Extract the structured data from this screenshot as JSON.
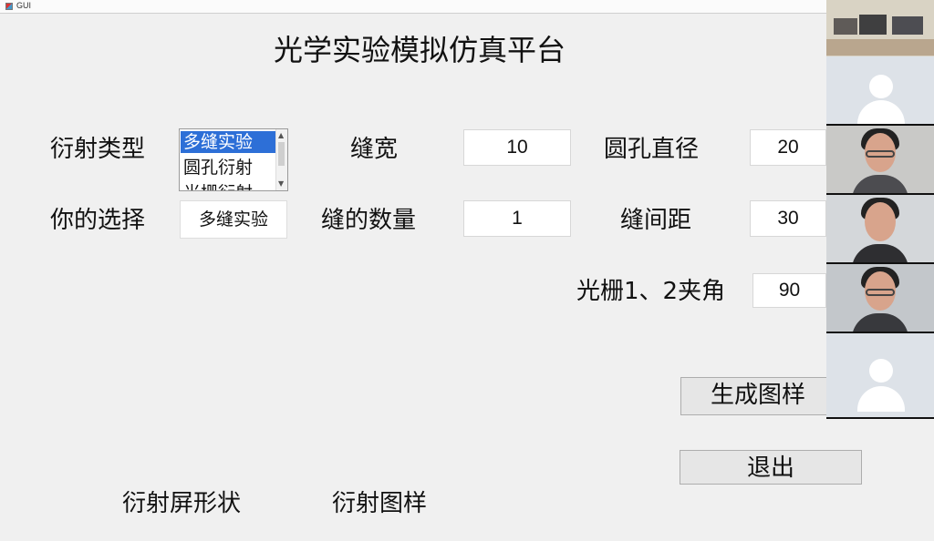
{
  "window": {
    "title": "GUI"
  },
  "page": {
    "title": "光学实验模拟仿真平台"
  },
  "labels": {
    "diffraction_type": "衍射类型",
    "your_choice": "你的选择",
    "slit_width": "缝宽",
    "slit_count": "缝的数量",
    "hole_diameter": "圆孔直径",
    "slit_spacing": "缝间距",
    "grating_angle": "光栅1、2夹角",
    "screen_shape": "衍射屏形状",
    "pattern": "衍射图样"
  },
  "listbox": {
    "items": [
      "多缝实验",
      "圆孔衍射",
      "光栅衍射"
    ],
    "selected_index": 0
  },
  "choice": {
    "value": "多缝实验"
  },
  "inputs": {
    "slit_width": "10",
    "slit_count": "1",
    "hole_diameter": "20",
    "slit_spacing": "30",
    "grating_angle": "90"
  },
  "buttons": {
    "generate": "生成图样",
    "exit": "退出"
  },
  "icons": {
    "app": "matlab-figure-icon",
    "scroll_up": "chevron-up-icon",
    "scroll_down": "chevron-down-icon",
    "participant_avatar": "user-avatar-icon"
  },
  "colors": {
    "background": "#f0f0f0",
    "selected": "#2d6fd7",
    "button": "#e6e6e6"
  }
}
